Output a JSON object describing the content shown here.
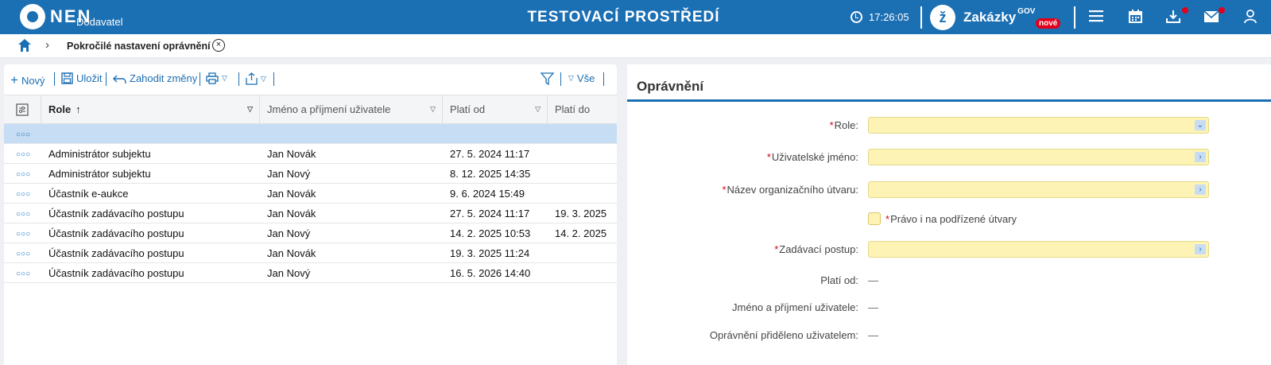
{
  "header": {
    "logo_text": "NEN",
    "logo_sub": "Dodavatel",
    "environment": "TESTOVACÍ PROSTŘEDÍ",
    "time": "17:26:05",
    "zakazky": "Zakázky",
    "zakazky_gov": "GOV",
    "zakazky_badge": "nové",
    "colors": {
      "bar": "#1b6fb3",
      "badge": "#e2001a"
    }
  },
  "breadcrumb": {
    "title": "Pokročilé nastavení oprávnění"
  },
  "toolbar": {
    "new_label": "Nový",
    "save_label": "Uložit",
    "discard_label": "Zahodit změny",
    "all_label": "Vše"
  },
  "grid": {
    "columns": [
      "Role",
      "Jméno a příjmení uživatele",
      "Platí od",
      "Platí do"
    ],
    "rows": [
      {
        "role": "",
        "user": "",
        "from": "",
        "to": ""
      },
      {
        "role": "Administrátor subjektu",
        "user": "Jan Novák",
        "from": "27. 5. 2024 11:17",
        "to": ""
      },
      {
        "role": "Administrátor subjektu",
        "user": "Jan Nový",
        "from": "8. 12. 2025 14:35",
        "to": ""
      },
      {
        "role": "Účastník e-aukce",
        "user": "Jan Novák",
        "from": "9. 6. 2024 15:49",
        "to": ""
      },
      {
        "role": "Účastník zadávacího postupu",
        "user": "Jan Novák",
        "from": "27. 5. 2024 11:17",
        "to": "19. 3. 2025"
      },
      {
        "role": "Účastník zadávacího postupu",
        "user": "Jan Nový",
        "from": "14. 2. 2025 10:53",
        "to": "14. 2. 2025"
      },
      {
        "role": "Účastník zadávacího postupu",
        "user": "Jan Novák",
        "from": "19. 3. 2025 11:24",
        "to": ""
      },
      {
        "role": "Účastník zadávacího postupu",
        "user": "Jan Nový",
        "from": "16. 5. 2026 14:40",
        "to": ""
      }
    ]
  },
  "form": {
    "title": "Oprávnění",
    "role_label": "Role:",
    "username_label": "Uživatelské jméno:",
    "org_label": "Název organizačního útvaru:",
    "sub_units_label": "Právo i na podřízené útvary",
    "procedure_label": "Zadávací postup:",
    "valid_from_label": "Platí od:",
    "valid_from_value": "—",
    "user_name_label": "Jméno a příjmení uživatele:",
    "user_name_value": "—",
    "assigned_by_label": "Oprávnění přiděleno uživatelem:",
    "assigned_by_value": "—"
  }
}
